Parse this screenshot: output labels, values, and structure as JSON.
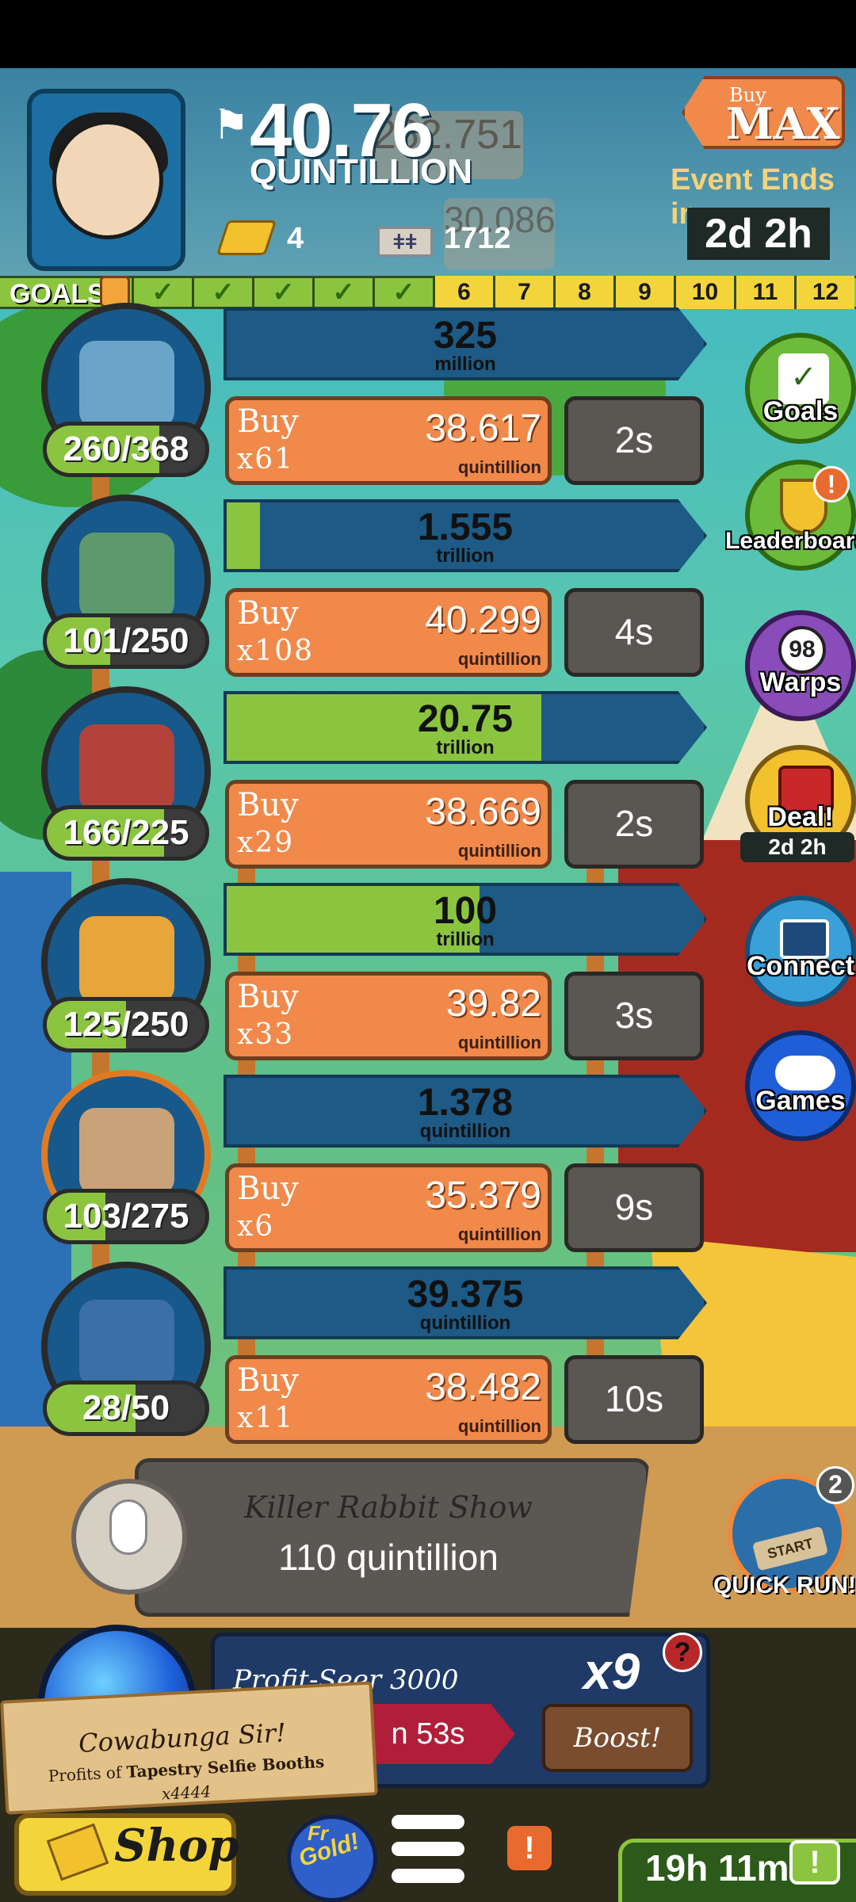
{
  "header": {
    "cash_value": "40.76",
    "cash_unit": "QUINTILLION",
    "gold_count": "4",
    "megabucks_count": "1712",
    "megabucks_symbol": "ǂǂ",
    "buy_max_top": "Buy",
    "buy_max_label": "MAX",
    "event_label": "Event Ends in:",
    "event_time": "2d 2h",
    "ghost_value": "262.751",
    "ghost_value2": "30.086",
    "cash_icon": "flag-icon",
    "colors": {
      "header_bg": "#3a82a3",
      "accent_orange": "#f0894a",
      "goal_green": "#8bc53f"
    }
  },
  "goals": {
    "label": "GOALS",
    "check_mark": "✓",
    "completed_count": 5,
    "pending": [
      "6",
      "7",
      "8",
      "9",
      "10",
      "11",
      "12"
    ]
  },
  "businesses": [
    {
      "owned": "260/368",
      "owned_fraction": 0.71,
      "progress_value": "325",
      "progress_unit": "million",
      "progress_fraction": 0.0,
      "buy_word": "Buy",
      "buy_qty": "x61",
      "cost": "38.617",
      "cost_unit": "quintillion",
      "time": "2s",
      "frame": "dark",
      "art_color": "#6aa4c8"
    },
    {
      "owned": "101/250",
      "owned_fraction": 0.4,
      "progress_value": "1.555",
      "progress_unit": "trillion",
      "progress_fraction": 0.07,
      "buy_word": "Buy",
      "buy_qty": "x108",
      "cost": "40.299",
      "cost_unit": "quintillion",
      "time": "4s",
      "frame": "dark",
      "art_color": "#5c9a6e"
    },
    {
      "owned": "166/225",
      "owned_fraction": 0.74,
      "progress_value": "20.75",
      "progress_unit": "trillion",
      "progress_fraction": 0.66,
      "buy_word": "Buy",
      "buy_qty": "x29",
      "cost": "38.669",
      "cost_unit": "quintillion",
      "time": "2s",
      "frame": "dark",
      "art_color": "#b3433a"
    },
    {
      "owned": "125/250",
      "owned_fraction": 0.5,
      "progress_value": "100",
      "progress_unit": "trillion",
      "progress_fraction": 0.53,
      "buy_word": "Buy",
      "buy_qty": "x33",
      "cost": "39.82",
      "cost_unit": "quintillion",
      "time": "3s",
      "frame": "dark",
      "art_color": "#e8a53a"
    },
    {
      "owned": "103/275",
      "owned_fraction": 0.37,
      "progress_value": "1.378",
      "progress_unit": "quintillion",
      "progress_fraction": 0.0,
      "buy_word": "Buy",
      "buy_qty": "x6",
      "cost": "35.379",
      "cost_unit": "quintillion",
      "time": "9s",
      "frame": "orange",
      "art_color": "#c9a27a"
    },
    {
      "owned": "28/50",
      "owned_fraction": 0.56,
      "progress_value": "39.375",
      "progress_unit": "quintillion",
      "progress_fraction": 0.0,
      "buy_word": "Buy",
      "buy_qty": "x11",
      "cost": "38.482",
      "cost_unit": "quintillion",
      "time": "10s",
      "frame": "dark",
      "art_color": "#3a6fa8"
    }
  ],
  "side_menu": {
    "goals_label": "Goals",
    "leaderboard_label": "Leaderboard",
    "leaderboard_badge": "!",
    "warps_label": "Warps",
    "warps_count": "98",
    "deal_label": "Deal!",
    "deal_time": "2d 2h",
    "connect_label": "Connect",
    "games_label": "Games"
  },
  "killer_rabbit": {
    "title": "Killer Rabbit Show",
    "value": "110 quintillion"
  },
  "quick_run": {
    "label": "QUICK RUN!",
    "badge": "2",
    "art_label": "START"
  },
  "profit_seer": {
    "title": "Profit-Seer 3000",
    "multiplier": "x9",
    "help": "?",
    "timer": "n 53s",
    "boost_label": "Boost!"
  },
  "toast": {
    "title": "Cowabunga Sir!",
    "body_prefix": "Profits of",
    "business": "Tapestry Selfie Booths",
    "multiplier": "x4444"
  },
  "bottom": {
    "shop_label": "Shop",
    "free_gold_label": "Gold!",
    "free_gold_top": "Fr",
    "alert": "!",
    "event_timer": "19h 11m",
    "tv_label": "!"
  }
}
